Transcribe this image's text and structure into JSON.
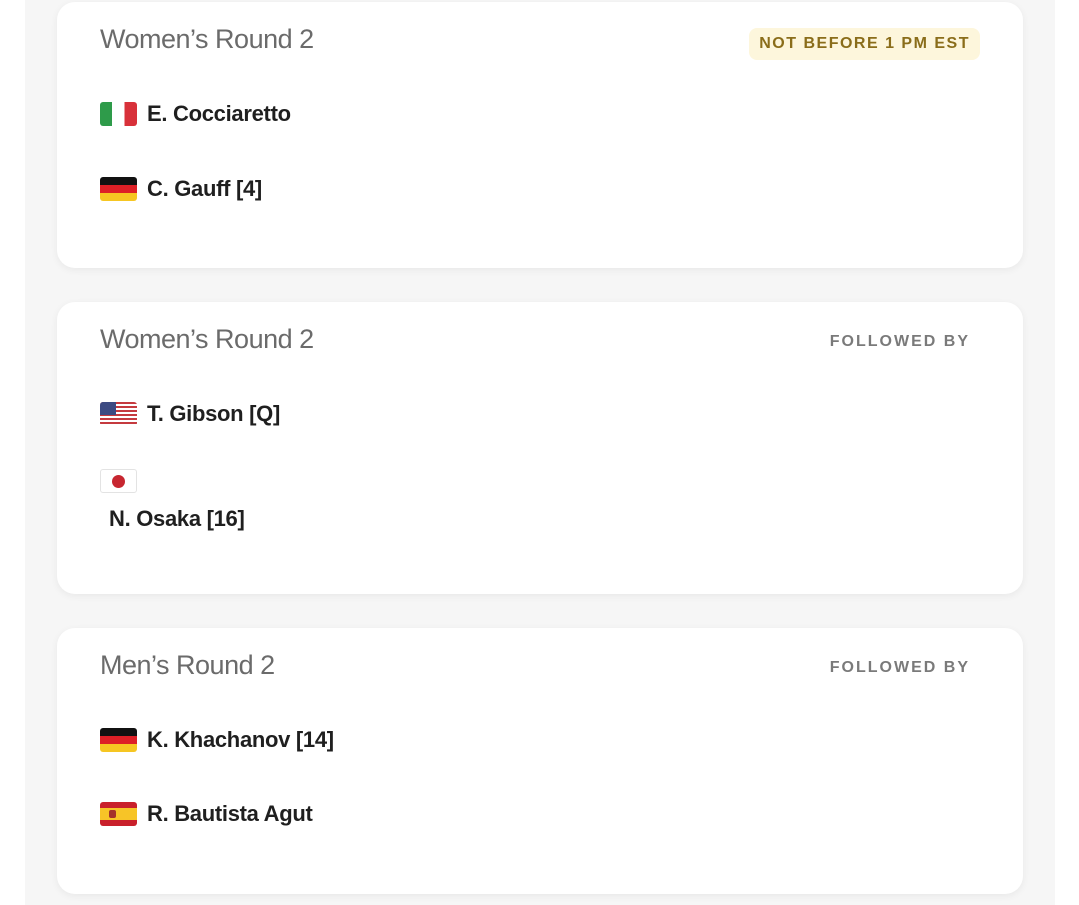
{
  "matches": [
    {
      "round": "Women’s Round 2",
      "badge": "NOT BEFORE 1 PM EST",
      "players": [
        {
          "name": "E. Cocciaretto",
          "flag": "italy-flag"
        },
        {
          "name": "C. Gauff [4]",
          "flag": "germany-flag"
        }
      ]
    },
    {
      "round": "Women’s Round 2",
      "badge": "FOLLOWED BY",
      "players": [
        {
          "name": "T. Gibson [Q]",
          "flag": "usa-flag"
        },
        {
          "name": "N. Osaka [16]",
          "flag": "japan-flag"
        }
      ]
    },
    {
      "round": "Men’s Round 2",
      "badge": "FOLLOWED BY",
      "players": [
        {
          "name": "K. Khachanov [14]",
          "flag": "germany-flag"
        },
        {
          "name": "R. Bautista Agut",
          "flag": "spain-flag"
        }
      ]
    }
  ],
  "colors": {
    "badge_highlight_bg": "#fdf6dc",
    "badge_highlight_text": "#8a6d1a",
    "title_text": "#6b6b6b",
    "player_text": "#1f1f1f"
  }
}
